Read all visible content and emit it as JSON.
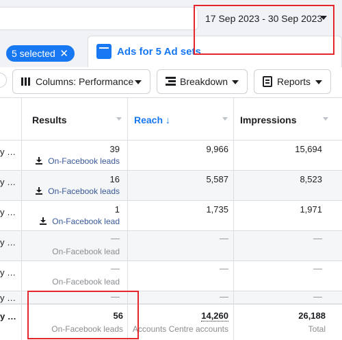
{
  "date_range": "17 Sep 2023 - 30 Sep 2023",
  "chip": {
    "label": "5 selected",
    "close": "✕"
  },
  "tab": {
    "label": "Ads for 5 Ad sets"
  },
  "toolbar": {
    "columns": "Columns: Performance",
    "breakdown": "Breakdown",
    "reports": "Reports"
  },
  "columns": {
    "results": "Results",
    "reach": "Reach ↓",
    "impressions": "Impressions"
  },
  "rows": [
    {
      "name": "y …",
      "results": "39",
      "results_label": "On-Facebook leads",
      "reach": "9,966",
      "impressions": "15,694"
    },
    {
      "name": "y …",
      "results": "16",
      "results_label": "On-Facebook leads",
      "reach": "5,587",
      "impressions": "8,523"
    },
    {
      "name": "y …",
      "results": "1",
      "results_label": "On-Facebook lead",
      "reach": "1,735",
      "impressions": "1,971"
    },
    {
      "name": "y …",
      "results": "—",
      "results_label": "On-Facebook lead",
      "reach": "—",
      "impressions": "—"
    },
    {
      "name": "y …",
      "results": "—",
      "results_label": "On-Facebook lead",
      "reach": "—",
      "impressions": "—"
    },
    {
      "name": "y …",
      "results": "—",
      "results_label": "",
      "reach": "—",
      "impressions": "—"
    }
  ],
  "totals": {
    "name": "y …",
    "results": "56",
    "results_label": "On-Facebook leads",
    "reach": "14,260",
    "reach_label": "Accounts Centre accounts",
    "impressions": "26,188",
    "impressions_label": "Total"
  },
  "colors": {
    "accent": "#1877f2",
    "highlight": "#e4262c",
    "link": "#385898"
  }
}
